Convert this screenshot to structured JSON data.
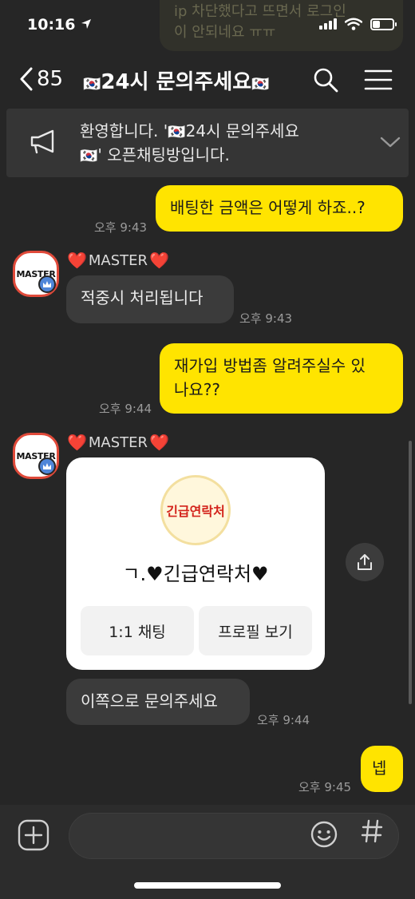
{
  "status_bar": {
    "time": "10:16"
  },
  "ghost_notification": {
    "line1": "ip 차단했다고 뜨면서 로그인",
    "line2": "이 안되네요 ㅠㅠ"
  },
  "header": {
    "back_count": "85",
    "title_flag_left": "🇰🇷",
    "title_text": "24시 문의주세요",
    "title_flag_right": "🇰🇷"
  },
  "notice": {
    "text_part1": "환영합니다. '",
    "text_flag1": "🇰🇷",
    "text_part2": "24시 문의주세요",
    "text_flag2": "🇰🇷",
    "text_part3": "' 오픈채팅방입니다."
  },
  "messages": {
    "m1": {
      "text": "배팅한 금액은 어떻게 하죠..?",
      "time": "오후 9:43"
    },
    "m2": {
      "sender": "MASTER",
      "text": "적중시 처리됩니다",
      "time": "오후 9:43",
      "avatar_text": "MASTER"
    },
    "m3": {
      "line1": "재가입 방법좀 알려주실수 있",
      "line2": "나요??",
      "time": "오후 9:44"
    },
    "m4": {
      "sender": "MASTER",
      "avatar_text": "MASTER",
      "card": {
        "logo_text": "긴급연락처",
        "title": "ㄱ.♥긴급연락처♥",
        "button1": "1:1 채팅",
        "button2": "프로필 보기"
      }
    },
    "m5": {
      "text": "이쪽으로 문의주세요",
      "time": "오후 9:44"
    },
    "m6": {
      "text": "넵",
      "time": "오후 9:45"
    }
  },
  "heart": "❤️",
  "colors": {
    "background": "#262626",
    "my_bubble": "#ffe400",
    "other_bubble": "#3b3b3b",
    "accent_badge": "#4f86d9"
  },
  "icons": [
    "back-chevron-icon",
    "search-icon",
    "menu-icon",
    "megaphone-icon",
    "chevron-down-icon",
    "crown-icon",
    "share-icon",
    "plus-icon",
    "emoji-icon",
    "hash-icon"
  ]
}
